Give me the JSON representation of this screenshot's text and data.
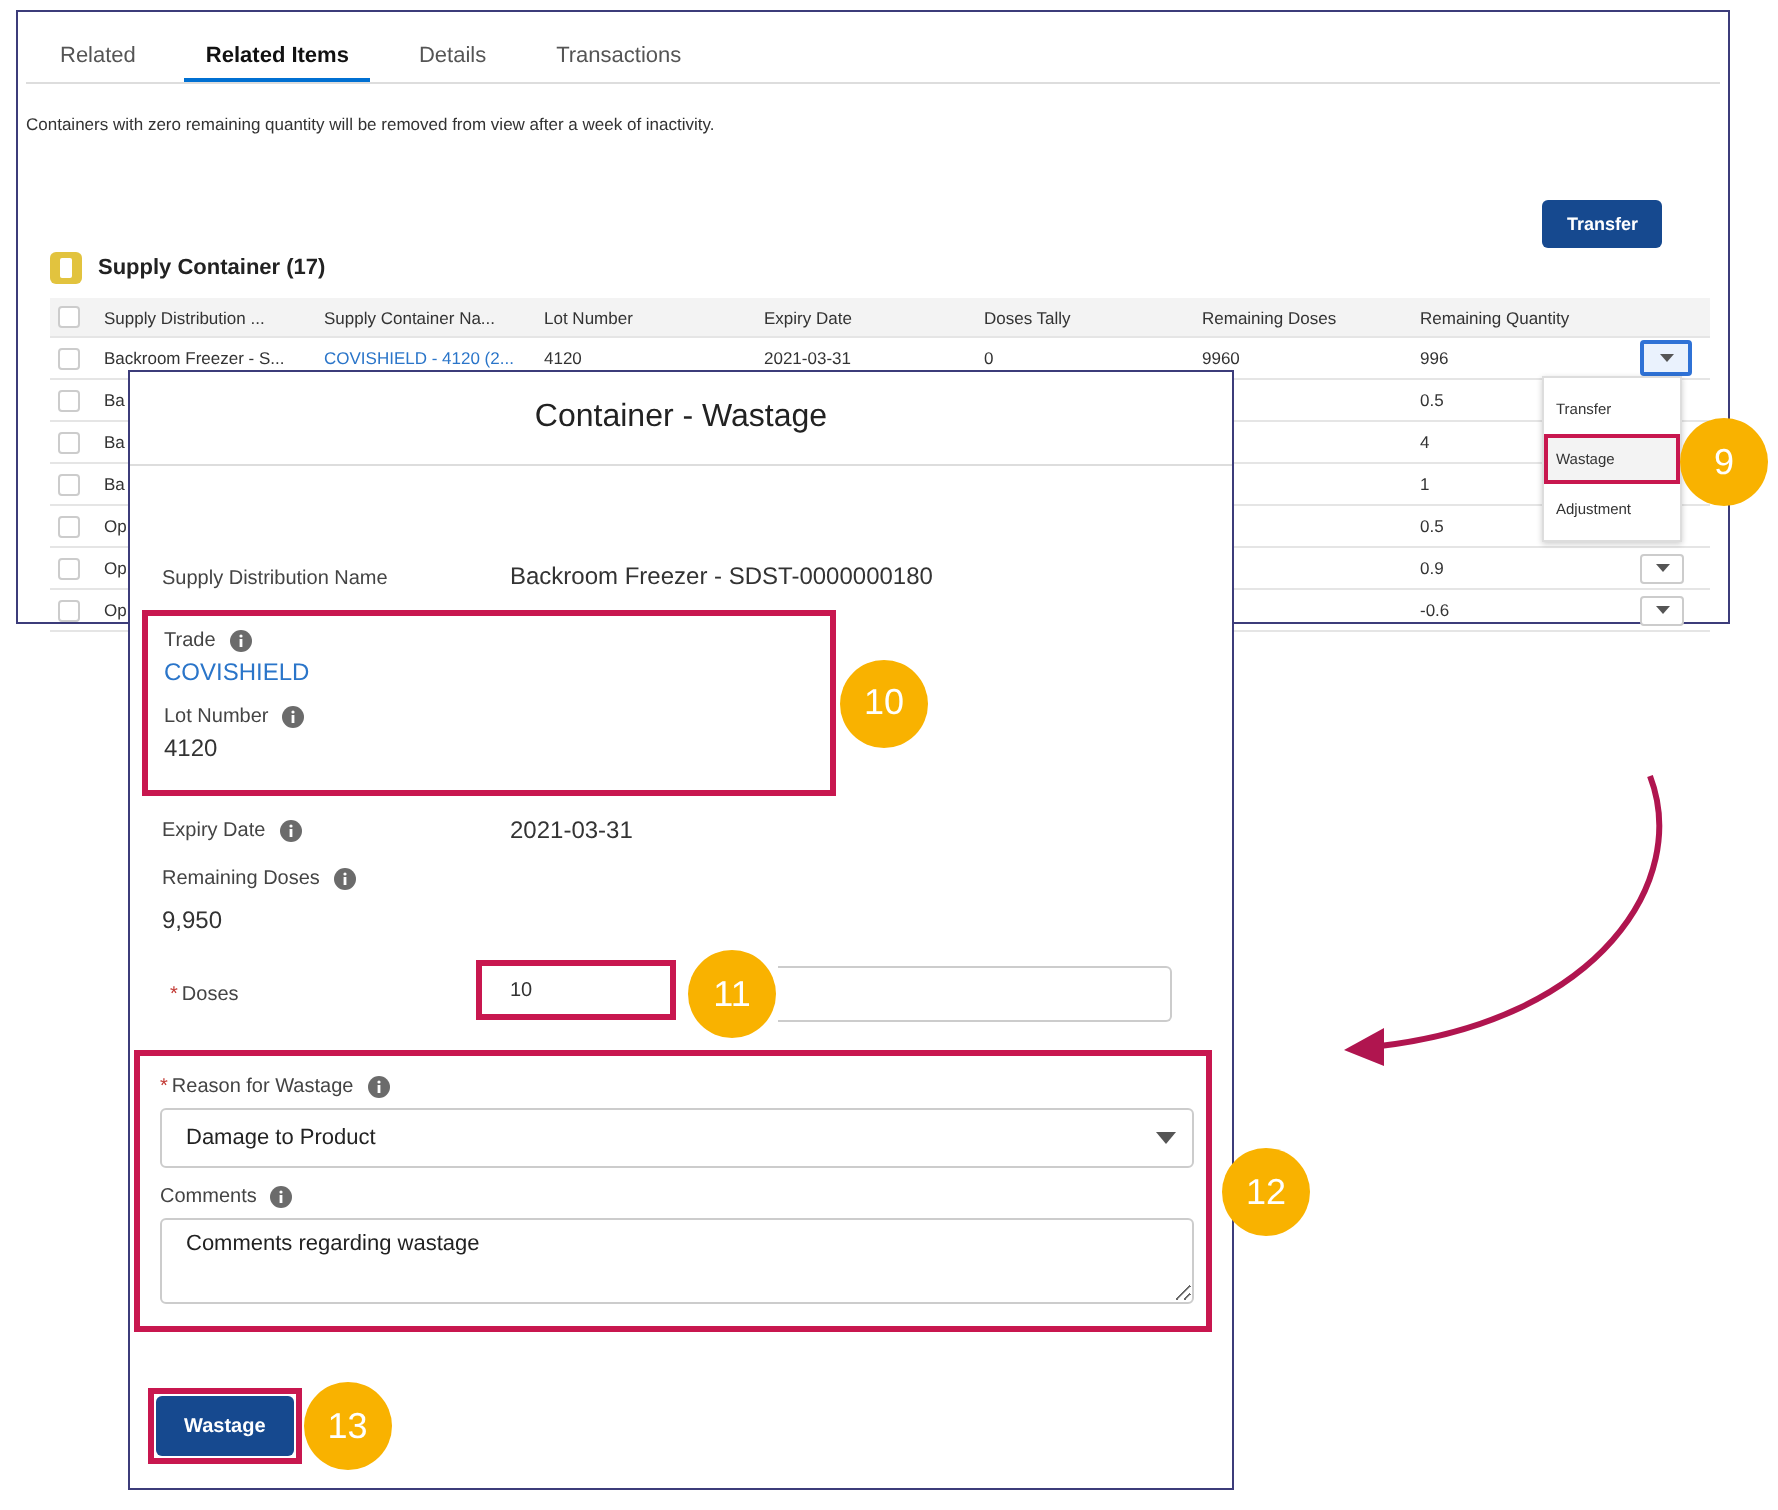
{
  "tabs": [
    {
      "label": "Related",
      "selected": false
    },
    {
      "label": "Related Items",
      "selected": true
    },
    {
      "label": "Details",
      "selected": false
    },
    {
      "label": "Transactions",
      "selected": false
    }
  ],
  "notice": "Containers with zero remaining quantity will be removed from view after a week of inactivity.",
  "transfer_button": "Transfer",
  "related_list": {
    "title": "Supply Container (17)",
    "header_checked": false,
    "columns": [
      {
        "label": "Supply Distribution ...",
        "kind": "text"
      },
      {
        "label": "Supply Container Na...",
        "kind": "link"
      },
      {
        "label": "Lot Number",
        "kind": "text"
      },
      {
        "label": "Expiry Date",
        "kind": "text"
      },
      {
        "label": "Doses Tally",
        "kind": "text"
      },
      {
        "label": "Remaining Doses",
        "kind": "text"
      },
      {
        "label": "Remaining Quantity",
        "kind": "text"
      }
    ],
    "rows": [
      {
        "kind": "full",
        "checked": false,
        "menu_button": true,
        "menu_open": true,
        "cells": [
          "Backroom Freezer - S...",
          "COVISHIELD - 4120 (2...",
          "4120",
          "2021-03-31",
          "0",
          "9960",
          "996"
        ]
      },
      {
        "kind": "covered",
        "checked": false,
        "cells": [
          "Ba",
          "0.5"
        ]
      },
      {
        "kind": "covered",
        "checked": false,
        "cells": [
          "Ba",
          "4"
        ]
      },
      {
        "kind": "covered",
        "checked": false,
        "cells": [
          "Ba",
          "1"
        ]
      },
      {
        "kind": "covered",
        "checked": false,
        "cells": [
          "Op",
          "0.5"
        ]
      },
      {
        "kind": "covered",
        "checked": false,
        "menu_button": true,
        "menu_open": false,
        "cells": [
          "Op",
          "0.9"
        ]
      },
      {
        "kind": "covered",
        "checked": false,
        "menu_button": true,
        "menu_open": false,
        "cells": [
          "Op",
          "-0.6"
        ]
      }
    ]
  },
  "row_menu": {
    "items": [
      {
        "label": "Transfer",
        "highlighted": false
      },
      {
        "label": "Wastage",
        "highlighted": true,
        "callout": "9"
      },
      {
        "label": "Adjustment",
        "highlighted": false
      }
    ]
  },
  "modal": {
    "title": "Container - Wastage",
    "supply_distribution": {
      "label": "Supply Distribution Name",
      "value": "Backroom Freezer - SDST-0000000180"
    },
    "highlight_group": {
      "callout": "10",
      "fields": [
        {
          "label": "Trade",
          "value": "COVISHIELD",
          "kind": "link",
          "info_icon": true
        },
        {
          "label": "Lot Number",
          "value": "4120",
          "kind": "text",
          "info_icon": true
        }
      ]
    },
    "expiry": {
      "label": "Expiry Date",
      "value": "2021-03-31",
      "info_icon": true
    },
    "remaining_doses": {
      "label": "Remaining Doses",
      "value": "9,950",
      "info_icon": true
    },
    "doses": {
      "label": "Doses",
      "required_mark": "*",
      "value": "10",
      "callout": "11"
    },
    "reason_group": {
      "callout": "12",
      "reason": {
        "label": "Reason for Wastage",
        "required_mark": "*",
        "value": "Damage to Product",
        "info_icon": true
      },
      "comments": {
        "label": "Comments",
        "value": "Comments regarding wastage",
        "info_icon": true
      }
    },
    "submit": {
      "label": "Wastage",
      "callout": "13"
    }
  }
}
